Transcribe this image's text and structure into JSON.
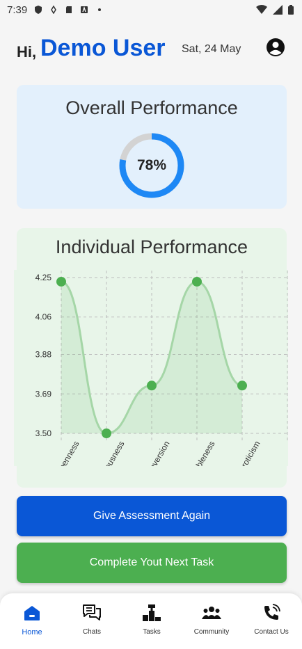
{
  "status_bar": {
    "time": "7:39"
  },
  "header": {
    "greeting": "Hi,",
    "username": "Demo User",
    "date": "Sat, 24 May"
  },
  "overall": {
    "title": "Overall Performance",
    "percent_label": "78%",
    "percent": 78
  },
  "individual": {
    "title": "Individual Performance"
  },
  "chart_data": {
    "type": "area",
    "categories": [
      "Openness",
      "Conscientiousness",
      "Extraversion",
      "Agreeableness",
      "Neuroticism"
    ],
    "values": [
      4.23,
      3.5,
      3.73,
      4.23,
      3.73
    ],
    "y_ticks": [
      "4.25",
      "4.06",
      "3.88",
      "3.69",
      "3.50"
    ],
    "ylim": [
      3.5,
      4.25
    ],
    "grid": true,
    "color": "#4caf50"
  },
  "buttons": {
    "assessment": "Give Assessment Again",
    "next_task": "Complete Yout Next Task"
  },
  "nav": {
    "items": [
      {
        "label": "Home",
        "icon": "home-icon"
      },
      {
        "label": "Chats",
        "icon": "chats-icon"
      },
      {
        "label": "Tasks",
        "icon": "tasks-icon"
      },
      {
        "label": "Community",
        "icon": "community-icon"
      },
      {
        "label": "Contact Us",
        "icon": "phone-icon"
      }
    ],
    "active": 0
  },
  "colors": {
    "brand_blue": "#0a57d6",
    "brand_green": "#4caf50",
    "card_blue": "#e3f0fc",
    "card_green": "#e8f5e9"
  }
}
